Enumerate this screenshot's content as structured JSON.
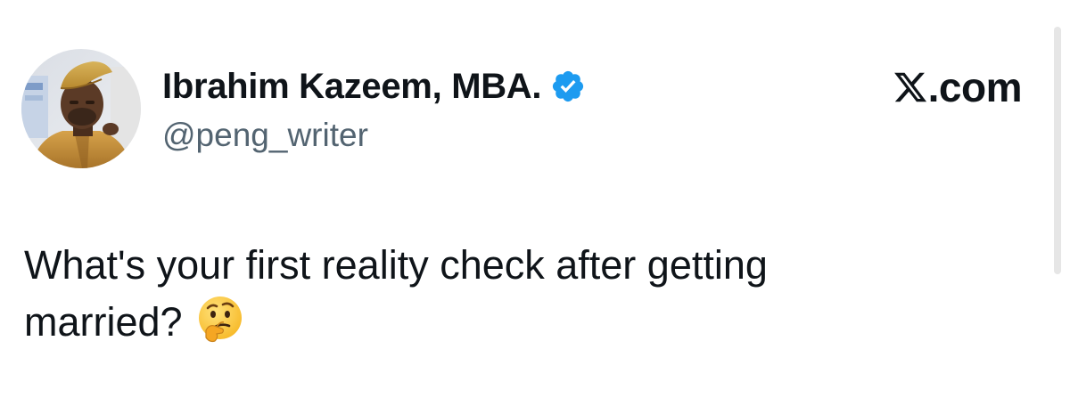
{
  "author": {
    "display_name": "Ibrahim Kazeem, MBA.",
    "handle": "@peng_writer",
    "verified": true,
    "avatar_icon": "avatar-photo"
  },
  "brand": {
    "logo_icon": "x-logo-icon",
    "suffix": ".com"
  },
  "tweet": {
    "line1": "What's your first reality check after getting",
    "line2": "married?",
    "emoji_icon": "thinking-face-emoji"
  },
  "colors": {
    "text_primary": "#0f1419",
    "text_secondary": "#536471",
    "verified_blue": "#1d9bf0",
    "background": "#ffffff"
  }
}
